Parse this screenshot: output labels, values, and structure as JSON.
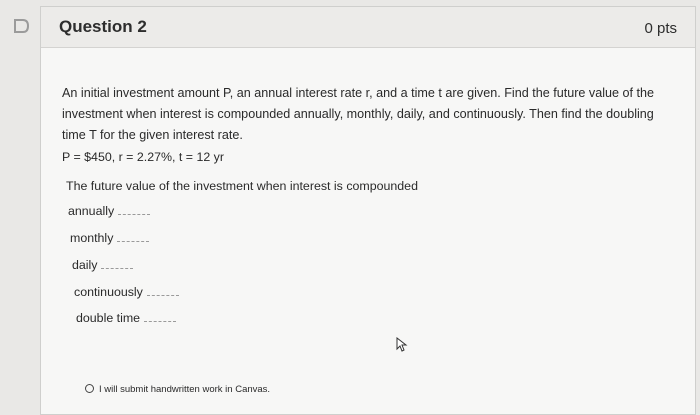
{
  "question": {
    "title": "Question 2",
    "points": "0 pts",
    "prompt": "An initial investment amount P, an annual interest rate r, and a time t are given. Find the future value of the investment when interest is compounded annually, monthly, daily, and continuously. Then find the doubling time T for the given interest rate.",
    "given": "P = $450, r = 2.27%, t = 12 yr",
    "intro": "The future value of the investment when interest is compounded",
    "fields": {
      "annually": "annually",
      "monthly": "monthly",
      "daily": "daily",
      "continuously": "continuously",
      "double_time": "double time"
    }
  },
  "answer_option": {
    "label": "I will submit handwritten work in Canvas."
  },
  "icons": {
    "flag": "flag-icon",
    "cursor": "mouse-cursor-icon"
  }
}
